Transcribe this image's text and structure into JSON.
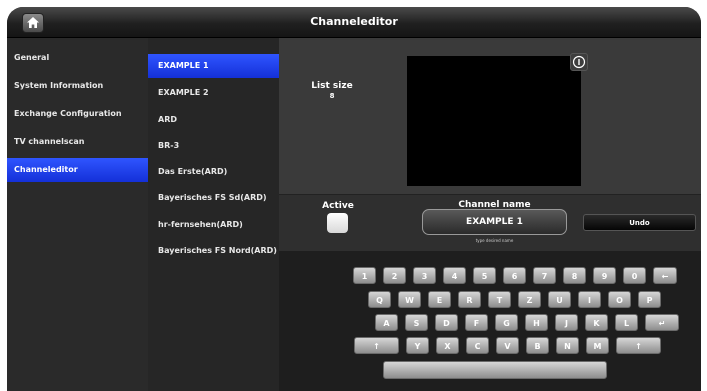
{
  "header": {
    "title": "Channeleditor",
    "home_icon": "home-icon"
  },
  "nav": {
    "items": [
      {
        "label": "General",
        "selected": false
      },
      {
        "label": "System Information",
        "selected": false
      },
      {
        "label": "Exchange Configuration",
        "selected": false
      },
      {
        "label": "TV channelscan",
        "selected": false
      },
      {
        "label": "Channeleditor",
        "selected": true
      }
    ]
  },
  "channels": {
    "items": [
      {
        "label": "EXAMPLE 1",
        "selected": true
      },
      {
        "label": "EXAMPLE 2",
        "selected": false
      },
      {
        "label": "ARD",
        "selected": false
      },
      {
        "label": "BR-3",
        "selected": false
      },
      {
        "label": "Das Erste(ARD)",
        "selected": false
      },
      {
        "label": "Bayerisches FS Sd(ARD)",
        "selected": false
      },
      {
        "label": "hr-fernsehen(ARD)",
        "selected": false
      },
      {
        "label": "Bayerisches FS Nord(ARD)",
        "selected": false
      }
    ]
  },
  "details": {
    "list_size_label": "List size",
    "list_size_value": "8",
    "info_icon": "info-icon",
    "active_label": "Active",
    "active_checked": false,
    "channel_name_label": "Channel name",
    "channel_name_value": "EXAMPLE 1",
    "channel_name_hint": "type desired name",
    "undo_label": "Undo"
  },
  "keyboard": {
    "rows": [
      [
        "1",
        "2",
        "3",
        "4",
        "5",
        "6",
        "7",
        "8",
        "9",
        "0",
        "←"
      ],
      [
        "Q",
        "W",
        "E",
        "R",
        "T",
        "Z",
        "U",
        "I",
        "O",
        "P"
      ],
      [
        "A",
        "S",
        "D",
        "F",
        "G",
        "H",
        "J",
        "K",
        "L",
        "↵"
      ],
      [
        "↑",
        "Y",
        "X",
        "C",
        "V",
        "B",
        "N",
        "M",
        "↑"
      ],
      [
        " "
      ]
    ]
  },
  "colors": {
    "accent": "#1f3cf0",
    "background": "#1c1c1c"
  }
}
